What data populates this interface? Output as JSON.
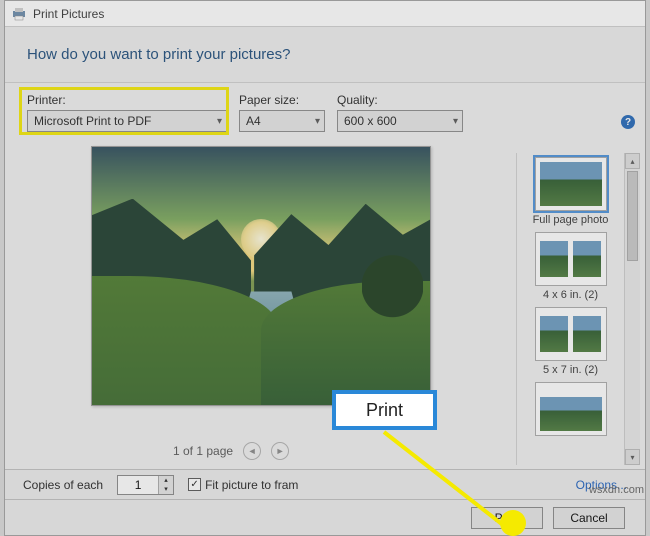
{
  "titlebar": {
    "title": "Print Pictures"
  },
  "header": {
    "question": "How do you want to print your pictures?"
  },
  "fields": {
    "printer_label": "Printer:",
    "printer_value": "Microsoft Print to PDF",
    "paper_label": "Paper size:",
    "paper_value": "A4",
    "quality_label": "Quality:",
    "quality_value": "600 x 600"
  },
  "help_glyph": "?",
  "pager": {
    "text": "1 of 1 page",
    "prev_glyph": "◄",
    "next_glyph": "►"
  },
  "layouts": {
    "items": [
      {
        "label": "Full page photo"
      },
      {
        "label": "4 x 6 in. (2)"
      },
      {
        "label": "5 x 7 in. (2)"
      },
      {
        "label": ""
      }
    ]
  },
  "footer": {
    "copies_label": "Copies of each",
    "copies_value": "1",
    "fit_label": "Fit picture to fram",
    "fit_check": "✓",
    "options_link": "Options...",
    "print_btn": "Print",
    "cancel_btn": "Cancel"
  },
  "callout": {
    "print_label": "Print"
  },
  "watermark": "wsxdn.com"
}
